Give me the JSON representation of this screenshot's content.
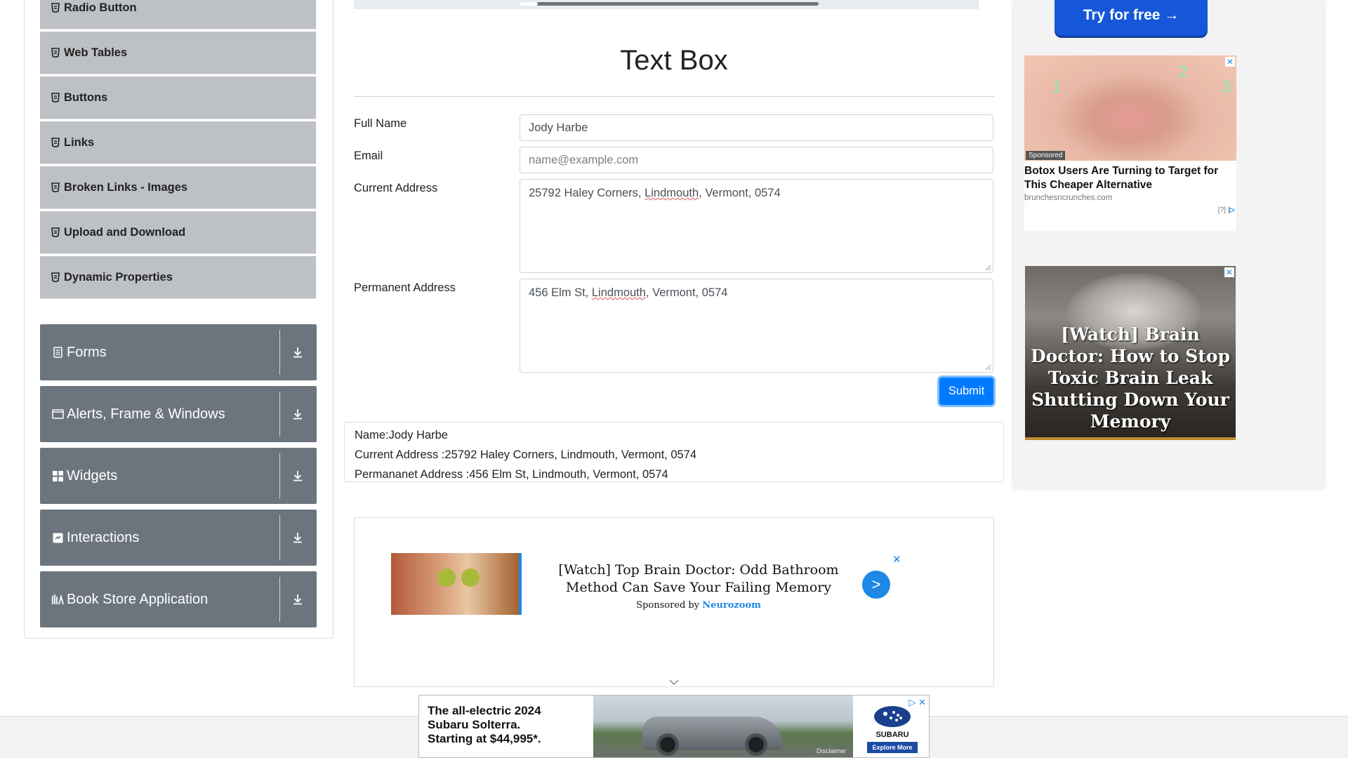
{
  "sidebar": {
    "elements_items": [
      {
        "label": "Radio Button"
      },
      {
        "label": "Web Tables"
      },
      {
        "label": "Buttons"
      },
      {
        "label": "Links"
      },
      {
        "label": "Broken Links - Images"
      },
      {
        "label": "Upload and Download"
      },
      {
        "label": "Dynamic Properties"
      }
    ],
    "groups": [
      {
        "label": "Forms",
        "icon": "form-icon"
      },
      {
        "label": "Alerts, Frame & Windows",
        "icon": "window-icon"
      },
      {
        "label": "Widgets",
        "icon": "widgets-icon"
      },
      {
        "label": "Interactions",
        "icon": "interactions-icon"
      },
      {
        "label": "Book Store Application",
        "icon": "bookstore-icon"
      }
    ]
  },
  "main": {
    "title": "Text Box",
    "form": {
      "full_name_label": "Full Name",
      "full_name_value": "Jody Harbe",
      "email_label": "Email",
      "email_placeholder": "name@example.com",
      "current_address_label": "Current Address",
      "current_address_pre": "25792 Haley Corners, ",
      "current_address_city": "Lindmouth",
      "current_address_post": ", Vermont, 0574",
      "permanent_address_label": "Permanent Address",
      "permanent_address_pre": "456 Elm St, ",
      "permanent_address_city": "Lindmouth",
      "permanent_address_post": ", Vermont, 0574",
      "submit_label": "Submit"
    },
    "output": {
      "name": "Name:Jody Harbe",
      "current_address": "Current Address :25792 Haley Corners, Lindmouth, Vermont, 0574",
      "permanent_address": "Permananet Address :456 Elm St, Lindmouth, Vermont, 0574"
    }
  },
  "ads": {
    "mid": {
      "headline": "[Watch] Top Brain Doctor: Odd Bathroom Method Can Save Your Failing Memory",
      "sponsored_by": "Sponsored by",
      "sponsor": "Neurozoom",
      "go": ">",
      "close": "✕"
    },
    "right_top": {
      "button": "Try for free →"
    },
    "botox": {
      "sponsored": "Sponsored",
      "headline": "Botox Users Are Turning to Target for This Cheaper Alternative",
      "source": "brunchesncrunches.com",
      "adchoices": "[?] |",
      "close": "✕",
      "numbers": [
        "1",
        "2",
        "3"
      ]
    },
    "brain": {
      "headline": "[Watch] Brain Doctor: How to Stop Toxic Brain Leak Shutting Down Your Memory",
      "close": "✕"
    },
    "subaru": {
      "headline": "The all-electric 2024 Subaru Solterra. Starting at $44,995*.",
      "brand": "SUBARU",
      "cta": "Explore More",
      "disclaimer": "Disclaimer",
      "controls": "▷ ✕"
    }
  },
  "colors": {
    "accent": "#007bff",
    "group_bg": "#6c757d",
    "sub_item_bg": "#bdc0c4"
  }
}
